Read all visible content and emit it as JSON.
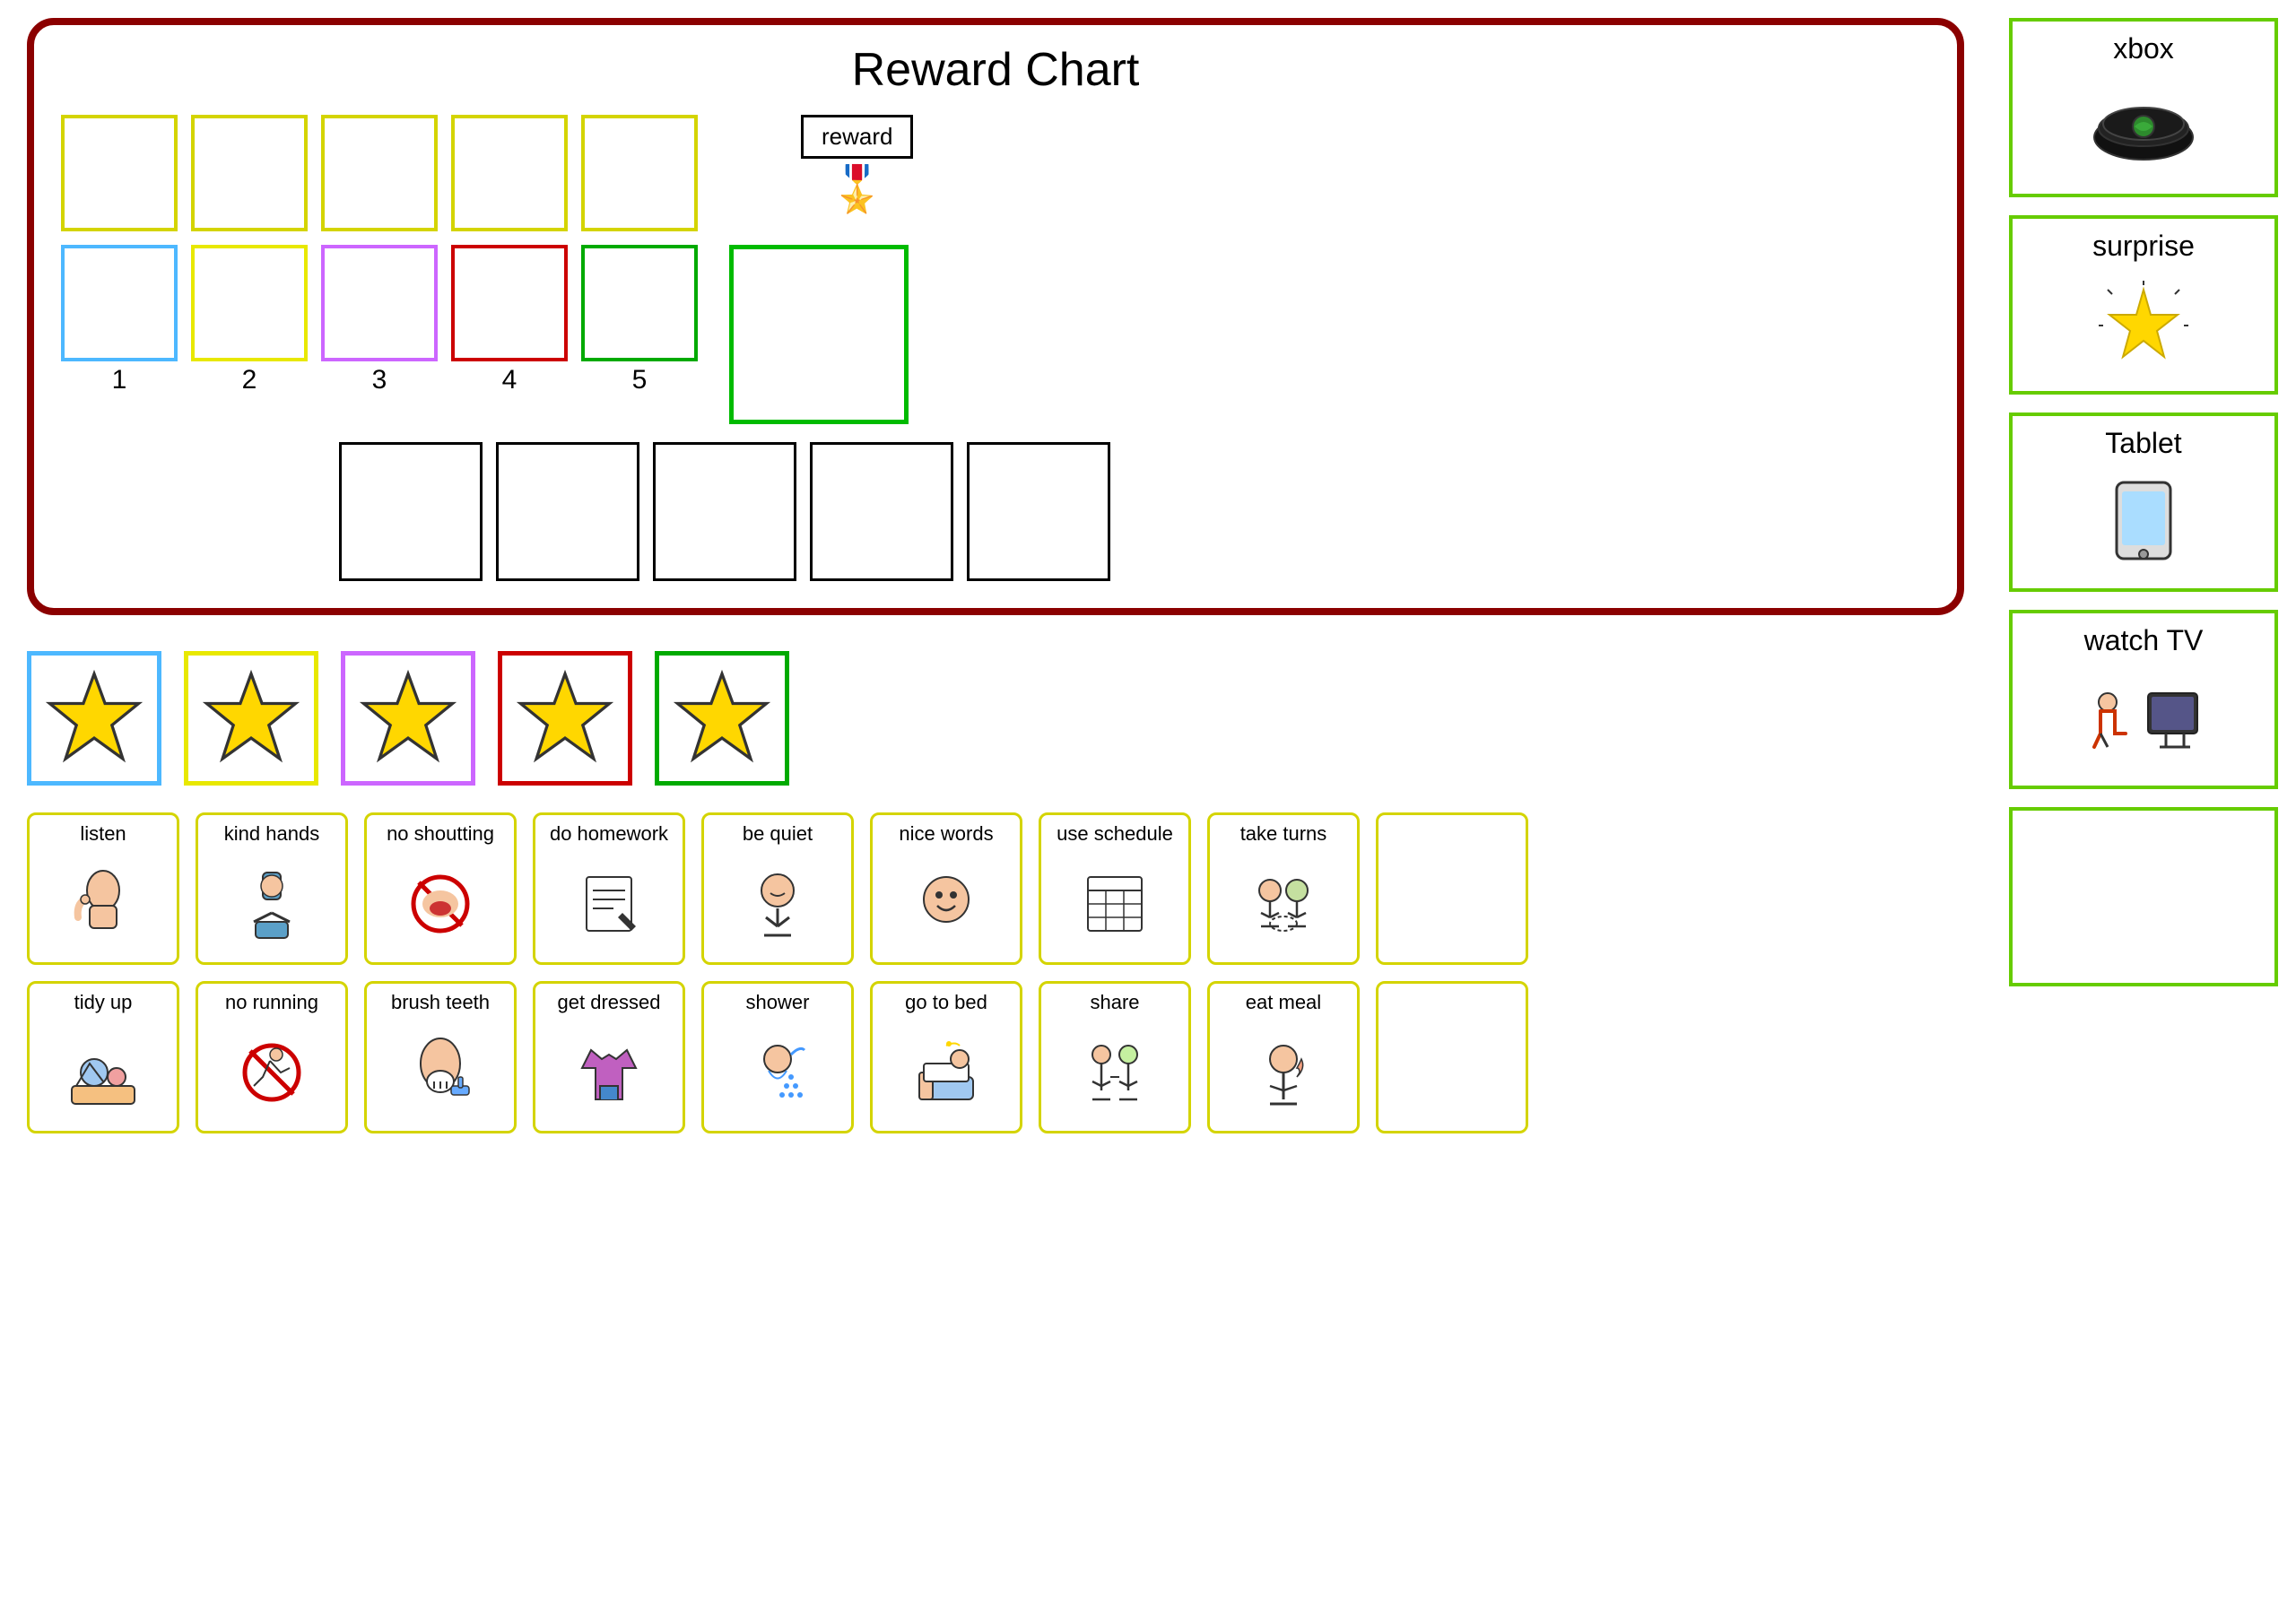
{
  "rewardChart": {
    "title": "Reward Chart",
    "topRow": {
      "boxes": [
        {
          "color": "yellow",
          "label": ""
        },
        {
          "color": "yellow",
          "label": ""
        },
        {
          "color": "yellow",
          "label": ""
        },
        {
          "color": "yellow",
          "label": ""
        },
        {
          "color": "yellow",
          "label": ""
        }
      ],
      "rewardBox": {
        "label": "reward"
      }
    },
    "numberedRow": {
      "boxes": [
        {
          "color": "blue",
          "number": "1"
        },
        {
          "color": "yellow2",
          "number": "2"
        },
        {
          "color": "purple",
          "number": "3"
        },
        {
          "color": "red",
          "number": "4"
        },
        {
          "color": "green",
          "number": "5"
        }
      ],
      "largeBox": {
        "color": "green-large"
      }
    },
    "bottomBoxes": [
      {
        "color": "black"
      },
      {
        "color": "black"
      },
      {
        "color": "black"
      },
      {
        "color": "black"
      },
      {
        "color": "black"
      }
    ]
  },
  "stars": [
    {
      "color": "blue",
      "label": "star-1"
    },
    {
      "color": "yellow",
      "label": "star-2"
    },
    {
      "color": "purple",
      "label": "star-3"
    },
    {
      "color": "red",
      "label": "star-4"
    },
    {
      "color": "green",
      "label": "star-5"
    }
  ],
  "activityRows": [
    [
      {
        "label": "listen",
        "icon": "👂"
      },
      {
        "label": "kind hands",
        "icon": "🤲"
      },
      {
        "label": "no shoutting",
        "icon": "🚫"
      },
      {
        "label": "do homework",
        "icon": "📚"
      },
      {
        "label": "be quiet",
        "icon": "🤫"
      },
      {
        "label": "nice words",
        "icon": "💬"
      },
      {
        "label": "use schedule",
        "icon": "📅"
      },
      {
        "label": "take turns",
        "icon": "👥"
      },
      {
        "label": "",
        "icon": ""
      }
    ],
    [
      {
        "label": "tidy up",
        "icon": "🧹"
      },
      {
        "label": "no running",
        "icon": "🚷"
      },
      {
        "label": "brush teeth",
        "icon": "🦷"
      },
      {
        "label": "get dressed",
        "icon": "👕"
      },
      {
        "label": "shower",
        "icon": "🚿"
      },
      {
        "label": "go to bed",
        "icon": "🛏️"
      },
      {
        "label": "share",
        "icon": "🤝"
      },
      {
        "label": "eat meal",
        "icon": "🍽️"
      },
      {
        "label": "",
        "icon": ""
      }
    ]
  ],
  "rewardItems": [
    {
      "title": "xbox",
      "icon": "🎮"
    },
    {
      "title": "surprise",
      "icon": "⭐"
    },
    {
      "title": "Tablet",
      "icon": "📱"
    },
    {
      "title": "watch TV",
      "icon": "📺"
    },
    {
      "title": "",
      "icon": ""
    }
  ]
}
